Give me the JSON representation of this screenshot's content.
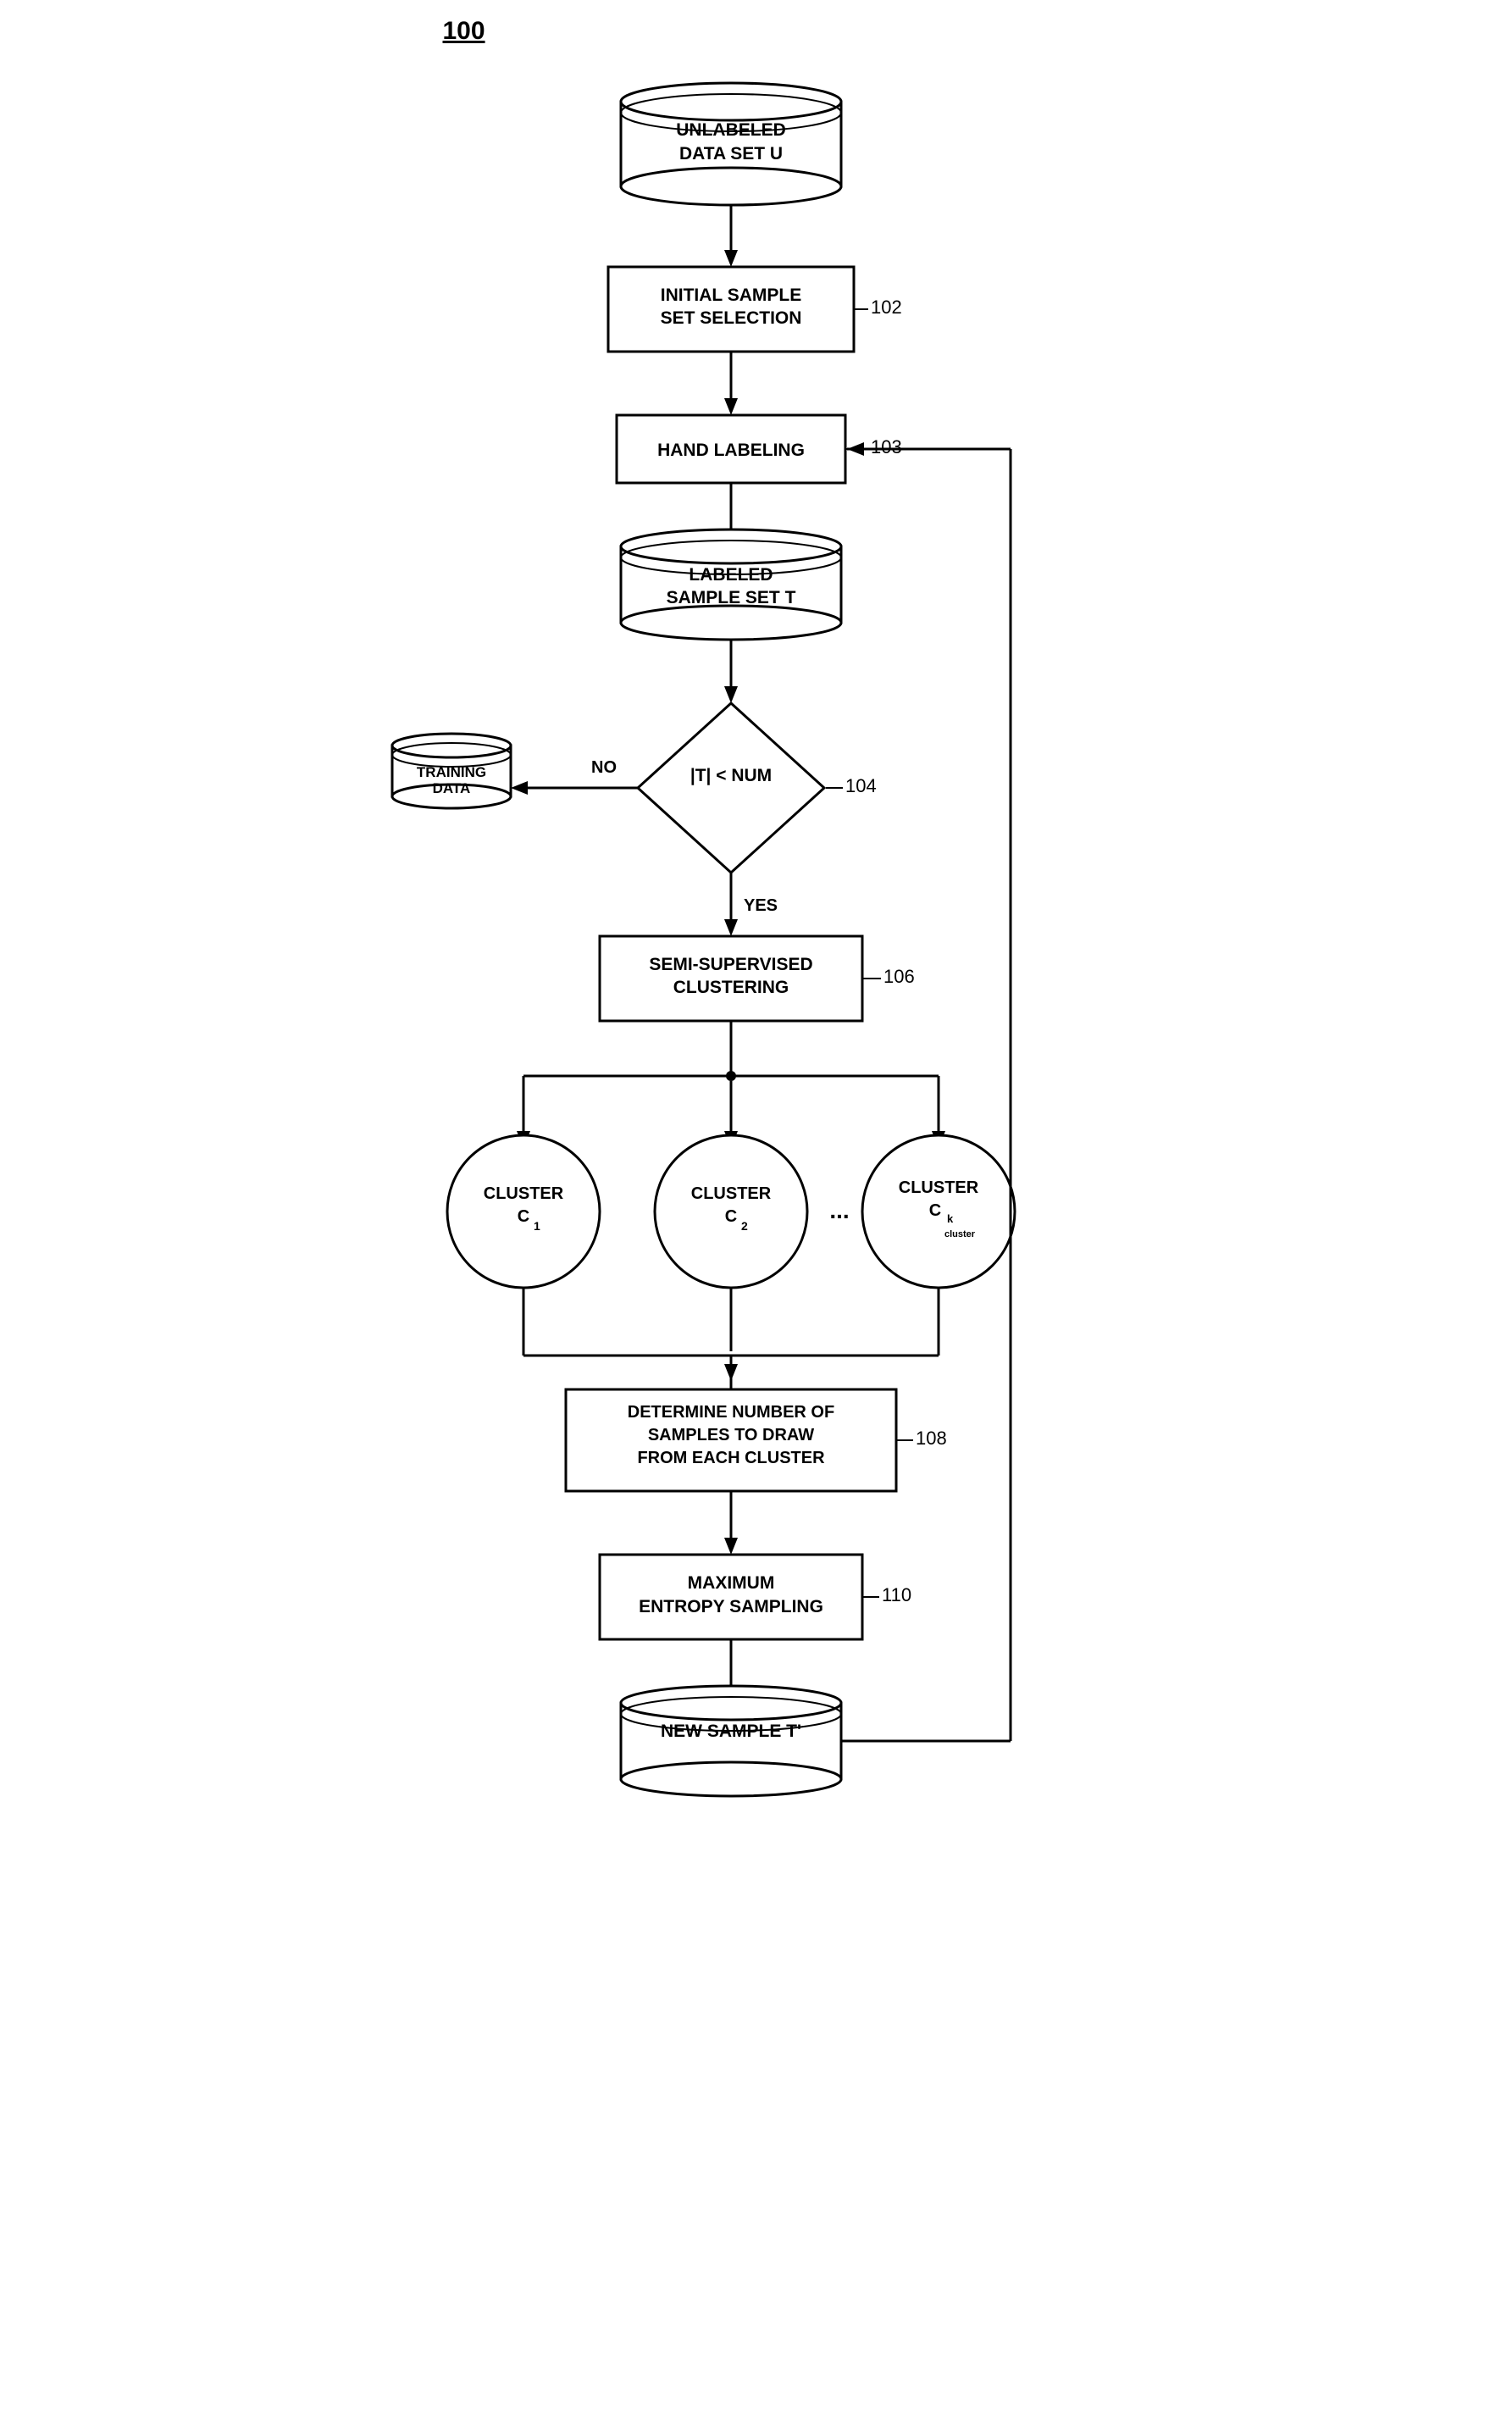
{
  "diagram": {
    "ref": "100",
    "nodes": {
      "unlabeled": "UNLABELED\nDATA SET U",
      "initial_sample": "INITIAL SAMPLE\nSET SELECTION",
      "hand_labeling": "HAND LABELING",
      "labeled_sample": "LABELED\nSAMPLE SET T",
      "decision": "|T| < NUM",
      "training_data": "TRAINING DATA",
      "semi_supervised": "SEMI-SUPERVISED\nCLUSTERING",
      "cluster1_top": "CLUSTER",
      "cluster1_sub": "C",
      "cluster1_subsub": "1",
      "cluster2_top": "CLUSTER",
      "cluster2_sub": "C",
      "cluster2_subsub": "2",
      "clusterk_top": "CLUSTER",
      "clusterk_sub": "C",
      "clusterk_subsub": "k",
      "clusterk_subsub2": "cluster",
      "ellipsis": "...",
      "determine": "DETERMINE NUMBER OF\nSAMPLES TO DRAW\nFROM EACH CLUSTER",
      "max_entropy": "MAXIMUM\nENTROPY SAMPLING",
      "new_sample": "NEW SAMPLE T'",
      "no_label": "NO",
      "yes_label": "YES",
      "step102": "102",
      "step103": "103",
      "step104": "104",
      "step106": "106",
      "step108": "108",
      "step110": "110"
    }
  }
}
